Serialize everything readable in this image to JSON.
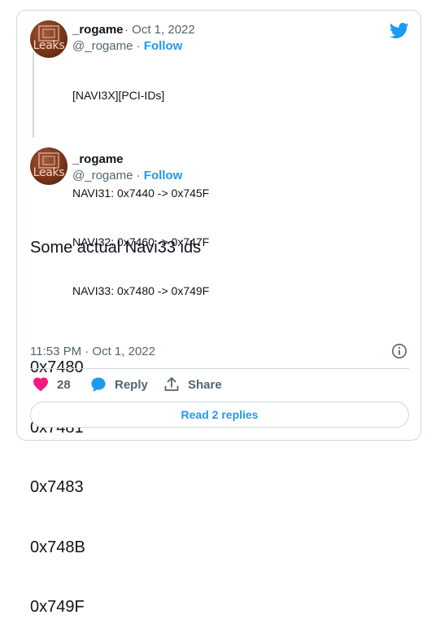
{
  "quoted_tweet": {
    "avatar_logo": "Leaks",
    "display_name": "_rogame",
    "separator": " · ",
    "date": "Oct 1, 2022",
    "handle": "@_rogame",
    "dot": " · ",
    "follow_label": "Follow",
    "lines": [
      "[NAVI3X][PCI-IDs]",
      "",
      "NAVI31: 0x7440 -> 0x745F",
      "NAVI32: 0x7460 -> 0x747F",
      "NAVI33: 0x7480 -> 0x749F"
    ]
  },
  "main_tweet": {
    "avatar_logo": "Leaks",
    "display_name": "_rogame",
    "handle": "@_rogame",
    "dot": " · ",
    "follow_label": "Follow",
    "lines": [
      "Some actual Navi33 ids",
      "",
      "0x7480",
      "0x7481",
      "0x7483",
      "0x748B",
      "0x749F"
    ],
    "timestamp": "11:53 PM · Oct 1, 2022"
  },
  "actions": {
    "likes_count": "28",
    "reply_label": "Reply",
    "share_label": "Share"
  },
  "read_replies_label": "Read 2 replies",
  "colors": {
    "accent": "#1d9bf0",
    "like": "#f91880",
    "muted": "#536471",
    "border": "#cfd9de"
  }
}
